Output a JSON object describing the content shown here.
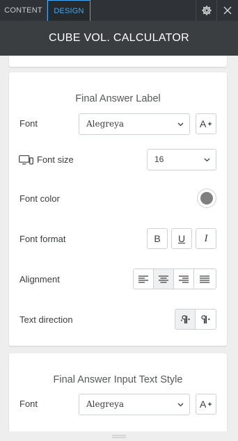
{
  "tabs": {
    "content": "CONTENT",
    "design": "DESIGN"
  },
  "icons": {
    "settings": "gear-icon",
    "close": "close-icon"
  },
  "header": {
    "title": "CUBE VOL. CALCULATOR"
  },
  "colors": {
    "accent": "#3fa9f5",
    "header_bg": "#3a3e41",
    "topbar_bg": "#2f3337",
    "font_color_value": "#808080"
  },
  "final_answer_label": {
    "title": "Final Answer Label",
    "font_label": "Font",
    "font_value": "Alegreya",
    "font_size_label": "Font size",
    "font_size_value": "16",
    "font_color_label": "Font color",
    "font_format_label": "Font format",
    "format_buttons": [
      "B",
      "U",
      "I"
    ],
    "alignment_label": "Alignment",
    "alignment_options": [
      "left",
      "center",
      "right",
      "justify"
    ],
    "alignment_selected": "center",
    "text_direction_label": "Text direction",
    "text_direction_options": [
      "ltr",
      "rtl"
    ],
    "text_direction_selected": "ltr"
  },
  "final_answer_input": {
    "title": "Final Answer Input Text Style",
    "font_label": "Font",
    "font_value": "Alegreya"
  }
}
